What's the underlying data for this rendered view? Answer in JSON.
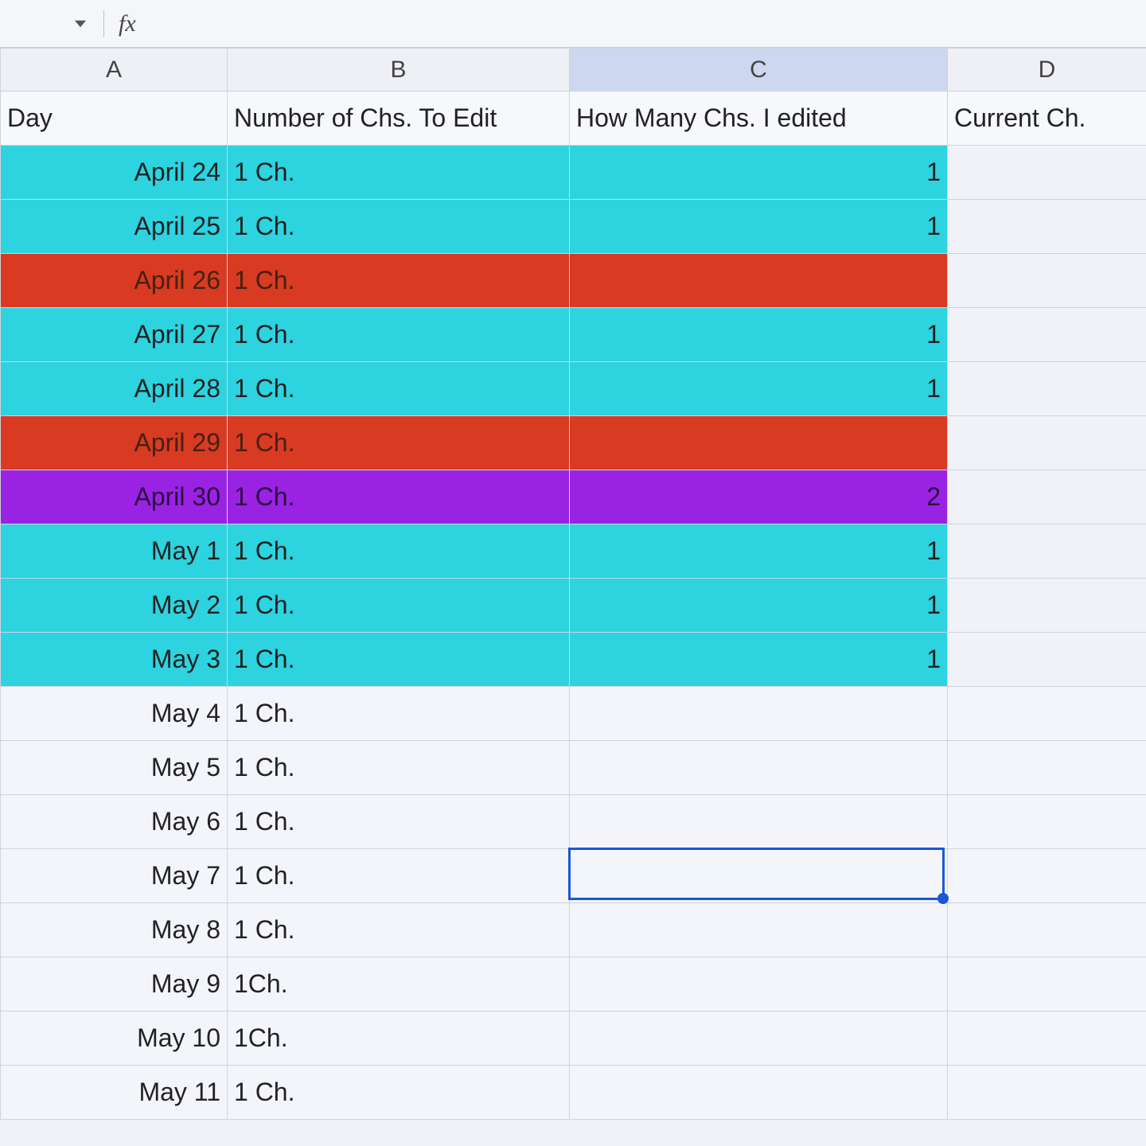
{
  "formula_bar": {
    "fx_label": "fx",
    "value": ""
  },
  "columns": [
    "A",
    "B",
    "C",
    "D"
  ],
  "selected_column": "C",
  "selected_cell": "C15",
  "header_row": {
    "A": "Day",
    "B": "Number of Chs. To Edit",
    "C": "How Many Chs. I edited",
    "D": "Current Ch."
  },
  "rows": [
    {
      "A": "April 24",
      "B": "1 Ch.",
      "C": "1",
      "D": "",
      "fill": "cyan"
    },
    {
      "A": "April 25",
      "B": "1 Ch.",
      "C": "1",
      "D": "",
      "fill": "cyan"
    },
    {
      "A": "April 26",
      "B": "1 Ch.",
      "C": "",
      "D": "",
      "fill": "red"
    },
    {
      "A": "April 27",
      "B": "1 Ch.",
      "C": "1",
      "D": "",
      "fill": "cyan"
    },
    {
      "A": "April 28",
      "B": "1 Ch.",
      "C": "1",
      "D": "",
      "fill": "cyan"
    },
    {
      "A": "April 29",
      "B": "1 Ch.",
      "C": "",
      "D": "",
      "fill": "red"
    },
    {
      "A": "April 30",
      "B": "1 Ch.",
      "C": "2",
      "D": "",
      "fill": "purple"
    },
    {
      "A": "May 1",
      "B": "1 Ch.",
      "C": "1",
      "D": "",
      "fill": "cyan"
    },
    {
      "A": "May 2",
      "B": "1 Ch.",
      "C": "1",
      "D": "",
      "fill": "cyan"
    },
    {
      "A": "May 3",
      "B": "1 Ch.",
      "C": "1",
      "D": "",
      "fill": "cyan"
    },
    {
      "A": "May 4",
      "B": "1 Ch.",
      "C": "",
      "D": "",
      "fill": "none"
    },
    {
      "A": "May 5",
      "B": "1 Ch.",
      "C": "",
      "D": "",
      "fill": "none"
    },
    {
      "A": "May 6",
      "B": "1 Ch.",
      "C": "",
      "D": "",
      "fill": "none"
    },
    {
      "A": "May 7",
      "B": "1 Ch.",
      "C": "",
      "D": "",
      "fill": "none"
    },
    {
      "A": "May 8",
      "B": "1 Ch.",
      "C": "",
      "D": "",
      "fill": "none"
    },
    {
      "A": "May 9",
      "B": "1Ch.",
      "C": "",
      "D": "",
      "fill": "none"
    },
    {
      "A": "May 10",
      "B": "1Ch.",
      "C": "",
      "D": "",
      "fill": "none"
    },
    {
      "A": "May 11",
      "B": "1 Ch.",
      "C": "",
      "D": "",
      "fill": "none"
    }
  ],
  "colors": {
    "cyan": "#2dd3df",
    "red": "#d93a22",
    "purple": "#9a23e3"
  }
}
